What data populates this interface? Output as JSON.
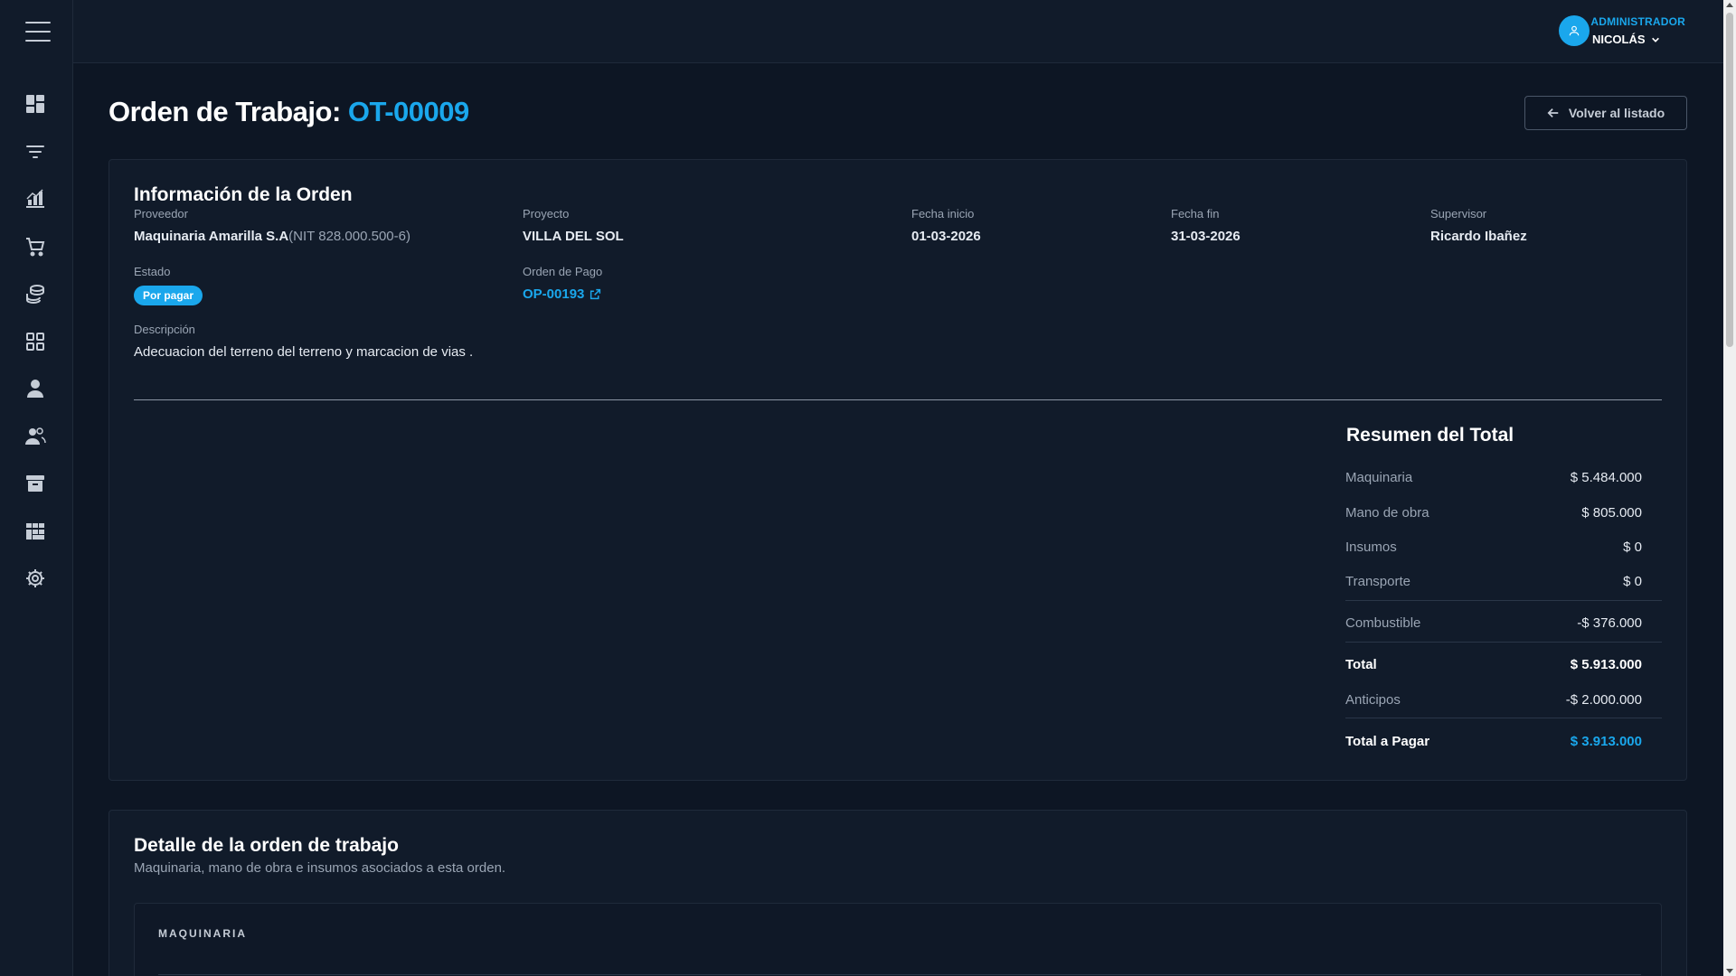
{
  "header": {
    "user_role": "ADMINISTRADOR",
    "user_name": "NICOLÁS",
    "accent_color": "#1aa7ec"
  },
  "sidebar": {
    "items": [
      {
        "icon": "dashboard-icon"
      },
      {
        "icon": "filter-icon"
      },
      {
        "icon": "chart-icon"
      },
      {
        "icon": "cart-icon"
      },
      {
        "icon": "coins-icon"
      },
      {
        "icon": "apps-grid-icon"
      },
      {
        "icon": "user-icon"
      },
      {
        "icon": "users-icon"
      },
      {
        "icon": "archive-icon"
      },
      {
        "icon": "table-grid-icon"
      },
      {
        "icon": "settings-icon"
      }
    ]
  },
  "page": {
    "title_prefix": "Orden de Trabajo: ",
    "title_code": "OT-00009",
    "back_label": "Volver al listado"
  },
  "info": {
    "title": "Información de la Orden",
    "proveedor_label": "Proveedor",
    "proveedor_value": "Maquinaria Amarilla S.A",
    "proveedor_nit": "(NIT 828.000.500-6)",
    "proyecto_label": "Proyecto",
    "proyecto_value": "VILLA DEL SOL",
    "fecha_inicio_label": "Fecha inicio",
    "fecha_inicio_value": "01-03-2026",
    "fecha_fin_label": "Fecha fin",
    "fecha_fin_value": "31-03-2026",
    "supervisor_label": "Supervisor",
    "supervisor_value": "Ricardo Ibañez",
    "estado_label": "Estado",
    "estado_value": "Por pagar",
    "orden_pago_label": "Orden de Pago",
    "orden_pago_value": "OP-00193",
    "descripcion_label": "Descripción",
    "descripcion_value": "Adecuacion del terreno del terreno y marcacion de vias ."
  },
  "summary": {
    "title": "Resumen del Total",
    "rows": [
      {
        "label": "Maquinaria",
        "value": "$ 5.484.000"
      },
      {
        "label": "Mano de obra",
        "value": "$ 805.000"
      },
      {
        "label": "Insumos",
        "value": "$ 0"
      },
      {
        "label": "Transporte",
        "value": "$ 0"
      },
      {
        "label": "Combustible",
        "value": "-$ 376.000"
      },
      {
        "label": "Total",
        "value": "$ 5.913.000"
      },
      {
        "label": "Anticipos",
        "value": "-$ 2.000.000"
      },
      {
        "label": "Total a Pagar",
        "value": "$ 3.913.000"
      }
    ]
  },
  "detail": {
    "title": "Detalle de la orden de trabajo",
    "subtitle": "Maquinaria, mano de obra e insumos asociados a esta orden.",
    "section_title": "MAQUINARIA"
  }
}
